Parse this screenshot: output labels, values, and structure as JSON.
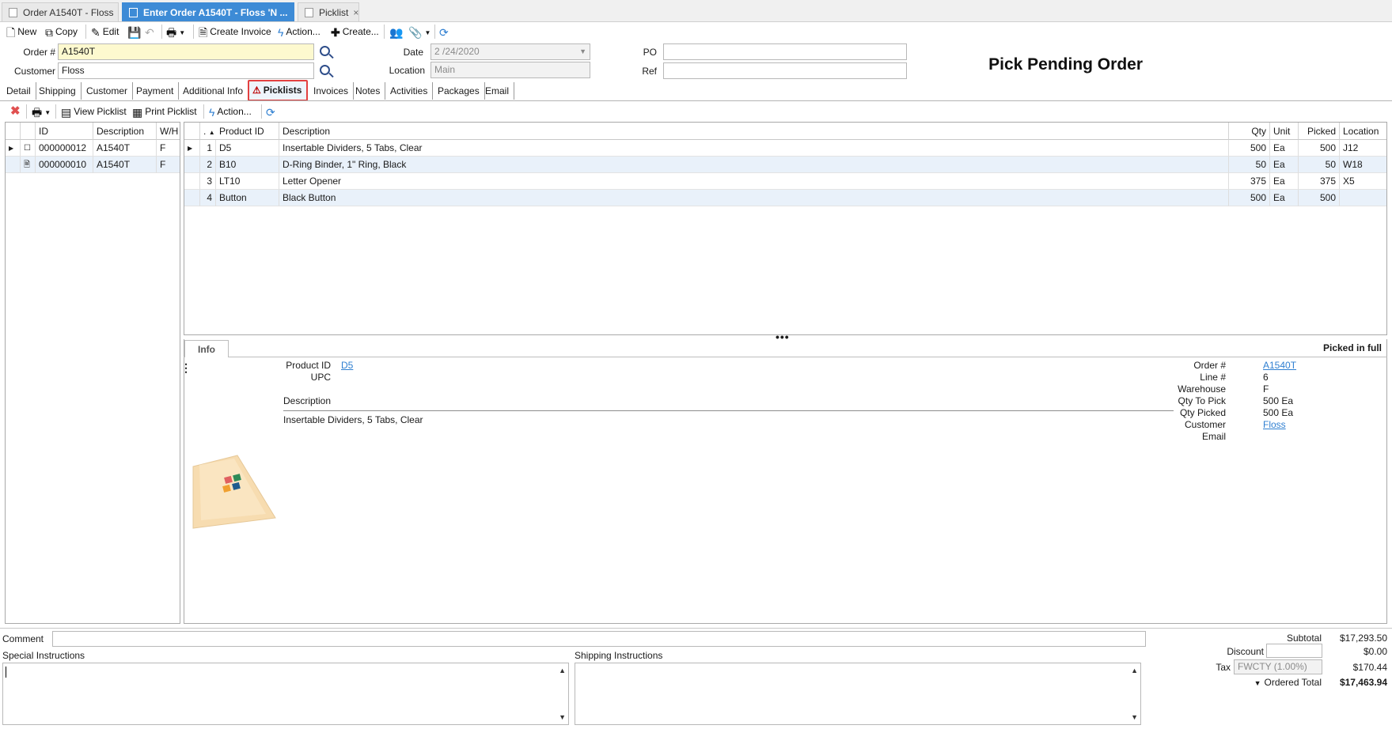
{
  "doc_tabs": [
    {
      "label": "Order A1540T - Floss",
      "close": "×"
    },
    {
      "label": "Enter Order A1540T - Floss 'N ...",
      "close": ""
    },
    {
      "label": "Picklist",
      "close": "×"
    }
  ],
  "toolbar": {
    "new": "New",
    "copy": "Copy",
    "edit": "Edit",
    "create_invoice": "Create Invoice",
    "action": "Action...",
    "create": "Create..."
  },
  "form": {
    "order_label": "Order #",
    "order_value": "A1540T",
    "customer_label": "Customer",
    "customer_value": "Floss",
    "date_label": "Date",
    "date_value": "2 /24/2020",
    "location_label": "Location",
    "location_value": "Main",
    "po_label": "PO",
    "po_value": "",
    "ref_label": "Ref",
    "ref_value": ""
  },
  "page_title": "Pick Pending Order",
  "section_tabs": [
    "Detail",
    "Shipping",
    "Customer",
    "Payment",
    "Additional Info",
    "Picklists",
    "Invoices",
    "Notes",
    "Activities",
    "Packages",
    "Email"
  ],
  "sub_toolbar": {
    "view_picklist": "View Picklist",
    "print_picklist": "Print Picklist",
    "action": "Action..."
  },
  "picklists": {
    "headers": [
      "ID",
      "Description",
      "W/H"
    ],
    "rows": [
      {
        "id": "000000012",
        "description": "A1540T",
        "wh": "F"
      },
      {
        "id": "000000010",
        "description": "A1540T",
        "wh": "F"
      }
    ]
  },
  "items": {
    "headers": [
      ".",
      "Product ID",
      "Description",
      "Qty",
      "Unit",
      "Picked",
      "Location"
    ],
    "rows": [
      {
        "n": "1",
        "product": "D5",
        "description": "Insertable Dividers, 5 Tabs, Clear",
        "qty": "500",
        "unit": "Ea",
        "picked": "500",
        "location": "J12"
      },
      {
        "n": "2",
        "product": "B10",
        "description": "D-Ring Binder, 1\" Ring, Black",
        "qty": "50",
        "unit": "Ea",
        "picked": "50",
        "location": "W18"
      },
      {
        "n": "3",
        "product": "LT10",
        "description": "Letter Opener",
        "qty": "375",
        "unit": "Ea",
        "picked": "375",
        "location": "X5"
      },
      {
        "n": "4",
        "product": "Button",
        "description": "Black Button",
        "qty": "500",
        "unit": "Ea",
        "picked": "500",
        "location": ""
      }
    ]
  },
  "info": {
    "tab_label": "Info",
    "status": "Picked in full",
    "product_id_label": "Product ID",
    "product_id": "D5",
    "upc_label": "UPC",
    "description_label": "Description",
    "description": "Insertable Dividers, 5 Tabs, Clear",
    "order_label": "Order #",
    "order": "A1540T",
    "line_label": "Line #",
    "line": "6",
    "warehouse_label": "Warehouse",
    "warehouse": "F",
    "qty_to_pick_label": "Qty To Pick",
    "qty_to_pick": "500 Ea",
    "qty_picked_label": "Qty Picked",
    "qty_picked": "500 Ea",
    "customer_label": "Customer",
    "customer": "Floss",
    "email_label": "Email"
  },
  "bottom": {
    "comment_label": "Comment",
    "special_label": "Special Instructions",
    "shipping_label": "Shipping Instructions"
  },
  "totals": {
    "subtotal_label": "Subtotal",
    "subtotal": "$17,293.50",
    "discount_label": "Discount",
    "discount": "$0.00",
    "tax_label": "Tax",
    "tax_code": "FWCTY (1.00%)",
    "tax": "$170.44",
    "ordered_total_label": "Ordered Total",
    "ordered_total": "$17,463.94"
  }
}
